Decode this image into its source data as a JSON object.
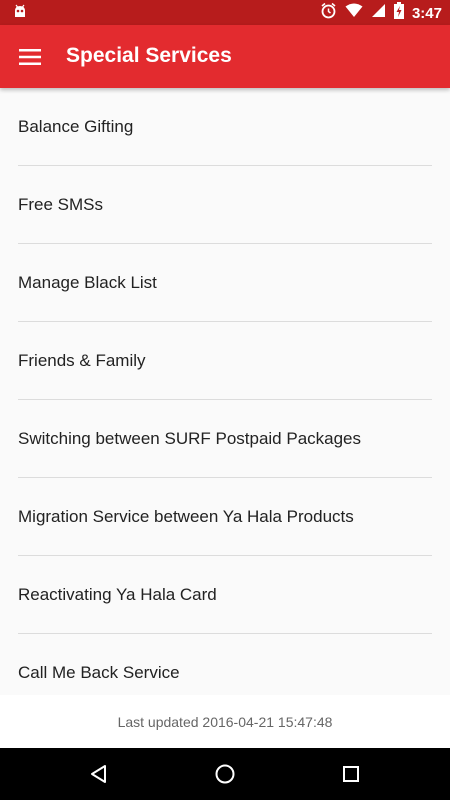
{
  "status_bar": {
    "time": "3:47"
  },
  "app_bar": {
    "title": "Special Services"
  },
  "services": [
    {
      "label": "Balance Gifting"
    },
    {
      "label": "Free SMSs"
    },
    {
      "label": "Manage Black List"
    },
    {
      "label": "Friends & Family"
    },
    {
      "label": "Switching between SURF Postpaid Packages"
    },
    {
      "label": "Migration Service between Ya Hala Products"
    },
    {
      "label": "Reactivating Ya Hala Card"
    },
    {
      "label": "Call Me Back Service"
    }
  ],
  "footer": {
    "last_updated": "Last updated 2016-04-21 15:47:48"
  },
  "colors": {
    "status_bar": "#b71c1c",
    "app_bar": "#e32b2f",
    "nav_bar": "#000000"
  },
  "icons": {
    "status_left": "android-debug-icon",
    "alarm": "alarm-clock-icon",
    "wifi": "wifi-icon",
    "signal": "cell-signal-icon",
    "battery": "battery-charging-icon",
    "menu": "hamburger-menu-icon",
    "back": "back-icon",
    "home": "home-icon",
    "recents": "recents-icon"
  }
}
